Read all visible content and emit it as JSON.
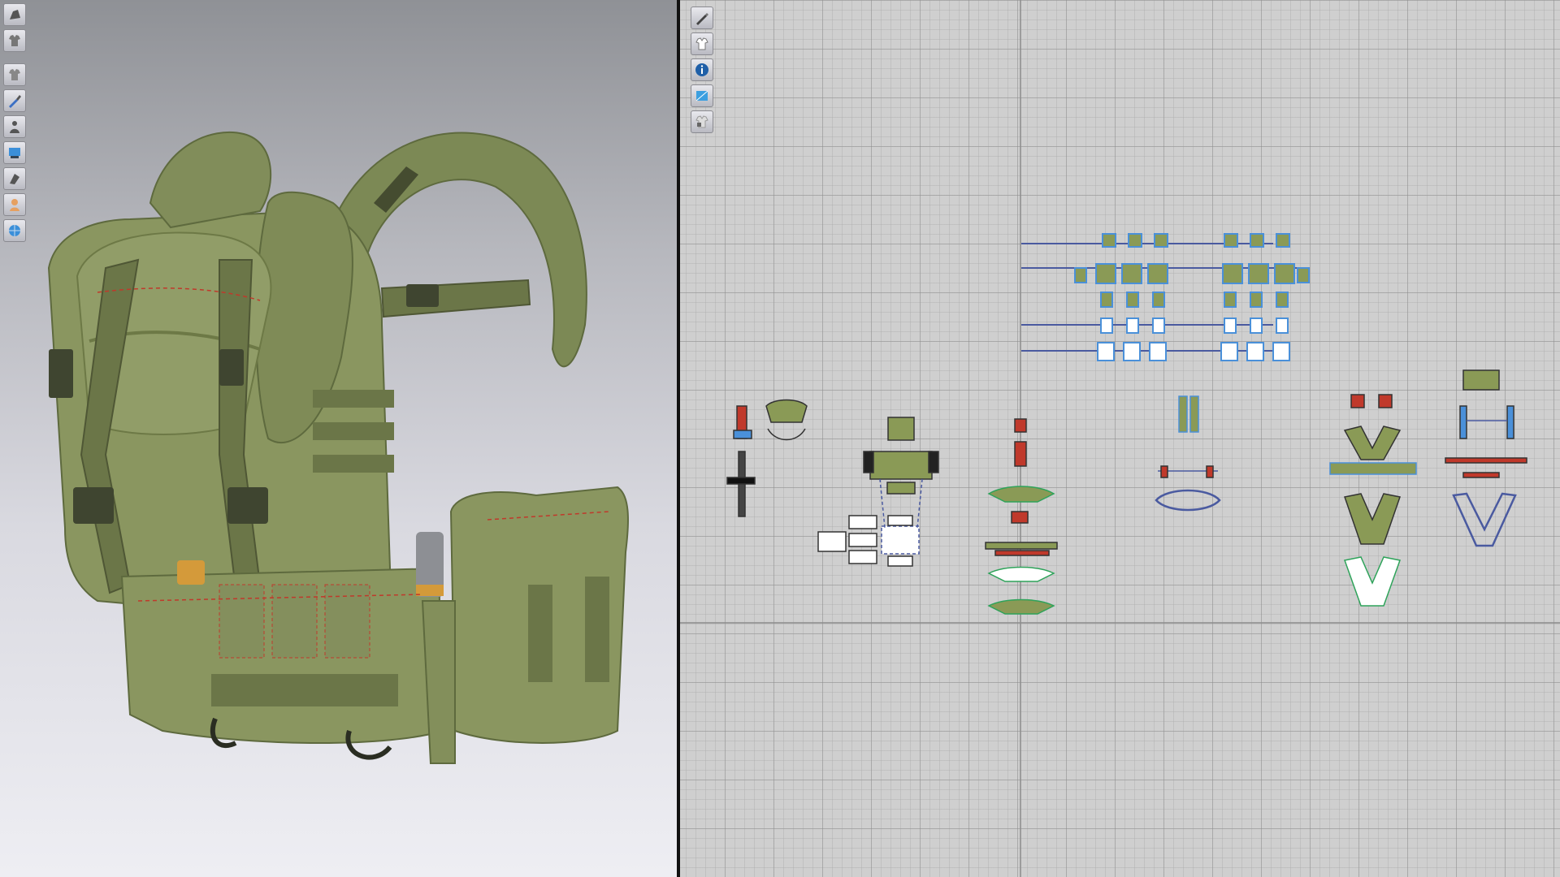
{
  "viewport_3d": {
    "toolbar": [
      {
        "icon": "avatar-display-icon"
      },
      {
        "icon": "garment-display-icon"
      },
      {
        "icon": "show-garment-icon"
      },
      {
        "icon": "texture-brush-icon"
      },
      {
        "icon": "show-avatar-icon"
      },
      {
        "icon": "view-mode-icon"
      },
      {
        "icon": "thickness-render-icon"
      },
      {
        "icon": "avatar-skin-icon"
      },
      {
        "icon": "environment-globe-icon"
      }
    ]
  },
  "viewport_2d": {
    "toolbar": [
      {
        "icon": "pencil-tool-icon"
      },
      {
        "icon": "garment-white-icon"
      },
      {
        "icon": "info-icon"
      },
      {
        "icon": "texture-view-icon"
      },
      {
        "icon": "lock-garment-icon"
      }
    ]
  },
  "colors": {
    "fabric": "#8a9660",
    "fabric_dark": "#5e6a3e",
    "strap": "#6b7648",
    "stitch": "#c0392b",
    "grid_bg": "#cfcfcf",
    "pattern_outline_blue": "#4a90d9",
    "pattern_fill": "#8a9a56"
  }
}
